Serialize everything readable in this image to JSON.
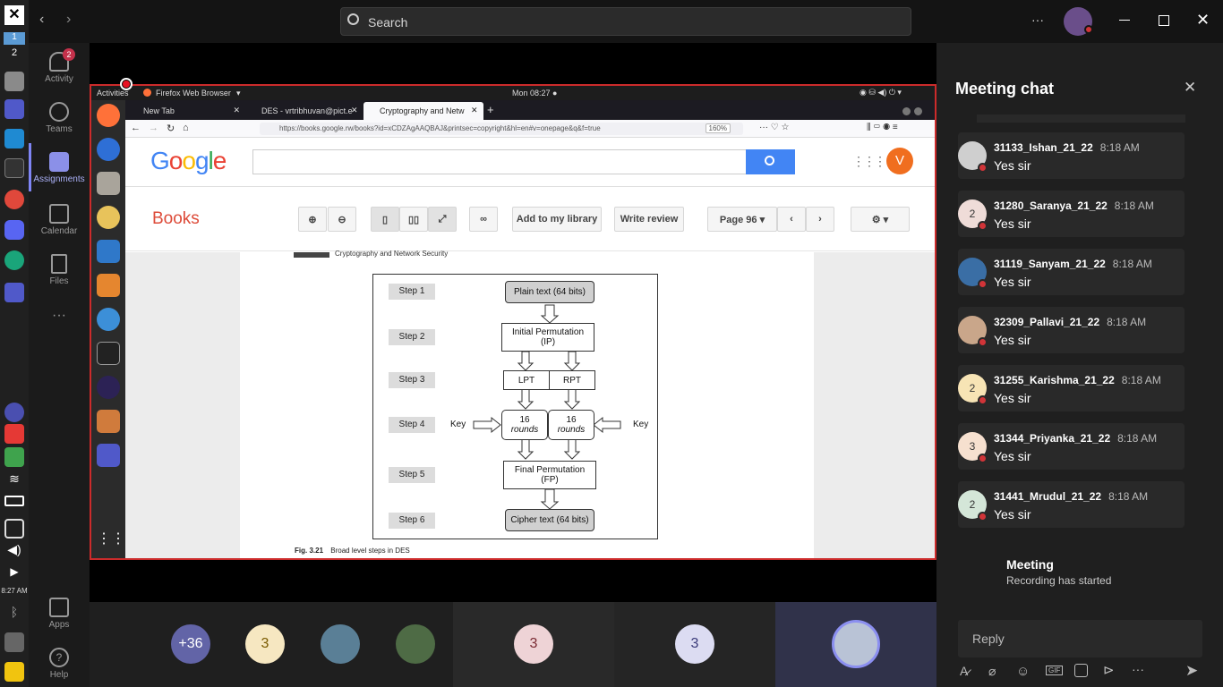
{
  "topbar": {
    "search_placeholder": "Search",
    "more_label": "···"
  },
  "taskbar": {
    "workspace_1": "1",
    "workspace_2": "2",
    "clock": "8:27 AM"
  },
  "rail": {
    "activity": {
      "label": "Activity",
      "badge": "2"
    },
    "teams": {
      "label": "Teams"
    },
    "assignments": {
      "label": "Assignments"
    },
    "calendar": {
      "label": "Calendar"
    },
    "files": {
      "label": "Files"
    },
    "more": "···",
    "apps": {
      "label": "Apps"
    },
    "help": {
      "label": "Help"
    }
  },
  "ubuntu": {
    "activities": "Activities",
    "app_name": "Firefox Web Browser",
    "clock": "Mon 08:27 ●"
  },
  "firefox": {
    "tabs": [
      {
        "label": "New Tab"
      },
      {
        "label": "DES - vrtribhuvan@pict.e"
      },
      {
        "label": "Cryptography and Netw"
      }
    ],
    "url": "https://books.google.rw/books?id=xCDZAgAAQBAJ&printsec=copyright&hl=en#v=onepage&q&f=true",
    "zoom": "160%"
  },
  "google": {
    "logo": "Google",
    "avatar_letter": "V"
  },
  "books": {
    "title": "Books",
    "add_library": "Add to my library",
    "write_review": "Write review",
    "page": "Page 96"
  },
  "diagram": {
    "header": "Cryptography and Network Security",
    "steps": [
      "Step 1",
      "Step 2",
      "Step 3",
      "Step 4",
      "Step 5",
      "Step 6"
    ],
    "plaintext": "Plain text (64 bits)",
    "ip_line1": "Initial Permutation",
    "ip_line2": "(IP)",
    "lpt": "LPT",
    "rpt": "RPT",
    "rounds_num": "16",
    "rounds_word": "rounds",
    "key": "Key",
    "fp_line1": "Final Permutation",
    "fp_line2": "(FP)",
    "ciphertext": "Cipher text (64 bits)",
    "fig_num": "Fig. 3.21",
    "fig_caption": "Broad level steps in DES"
  },
  "participants": {
    "overflow": "+36",
    "count_a": "3",
    "count_b": "3",
    "count_c": "3"
  },
  "chat": {
    "title": "Meeting chat",
    "messages": [
      {
        "name": "31133_Ishan_21_22",
        "time": "8:18 AM",
        "text": "Yes sir",
        "initial": "",
        "color": "#cfcfcf"
      },
      {
        "name": "31280_Saranya_21_22",
        "time": "8:18 AM",
        "text": "Yes sir",
        "initial": "2",
        "color": "#efdcd8"
      },
      {
        "name": "31119_Sanyam_21_22",
        "time": "8:18 AM",
        "text": "Yes sir",
        "initial": "",
        "color": "#3a6ea5"
      },
      {
        "name": "32309_Pallavi_21_22",
        "time": "8:18 AM",
        "text": "Yes sir",
        "initial": "",
        "color": "#c9a68a"
      },
      {
        "name": "31255_Karishma_21_22",
        "time": "8:18 AM",
        "text": "Yes sir",
        "initial": "2",
        "color": "#f7e4b5"
      },
      {
        "name": "31344_Priyanka_21_22",
        "time": "8:18 AM",
        "text": "Yes sir",
        "initial": "3",
        "color": "#f6e0cf"
      },
      {
        "name": "31441_Mrudul_21_22",
        "time": "8:18 AM",
        "text": "Yes sir",
        "initial": "2",
        "color": "#d4e6d8"
      }
    ],
    "meeting_title": "Meeting",
    "meeting_status": "Recording has started",
    "reply_placeholder": "Reply"
  }
}
